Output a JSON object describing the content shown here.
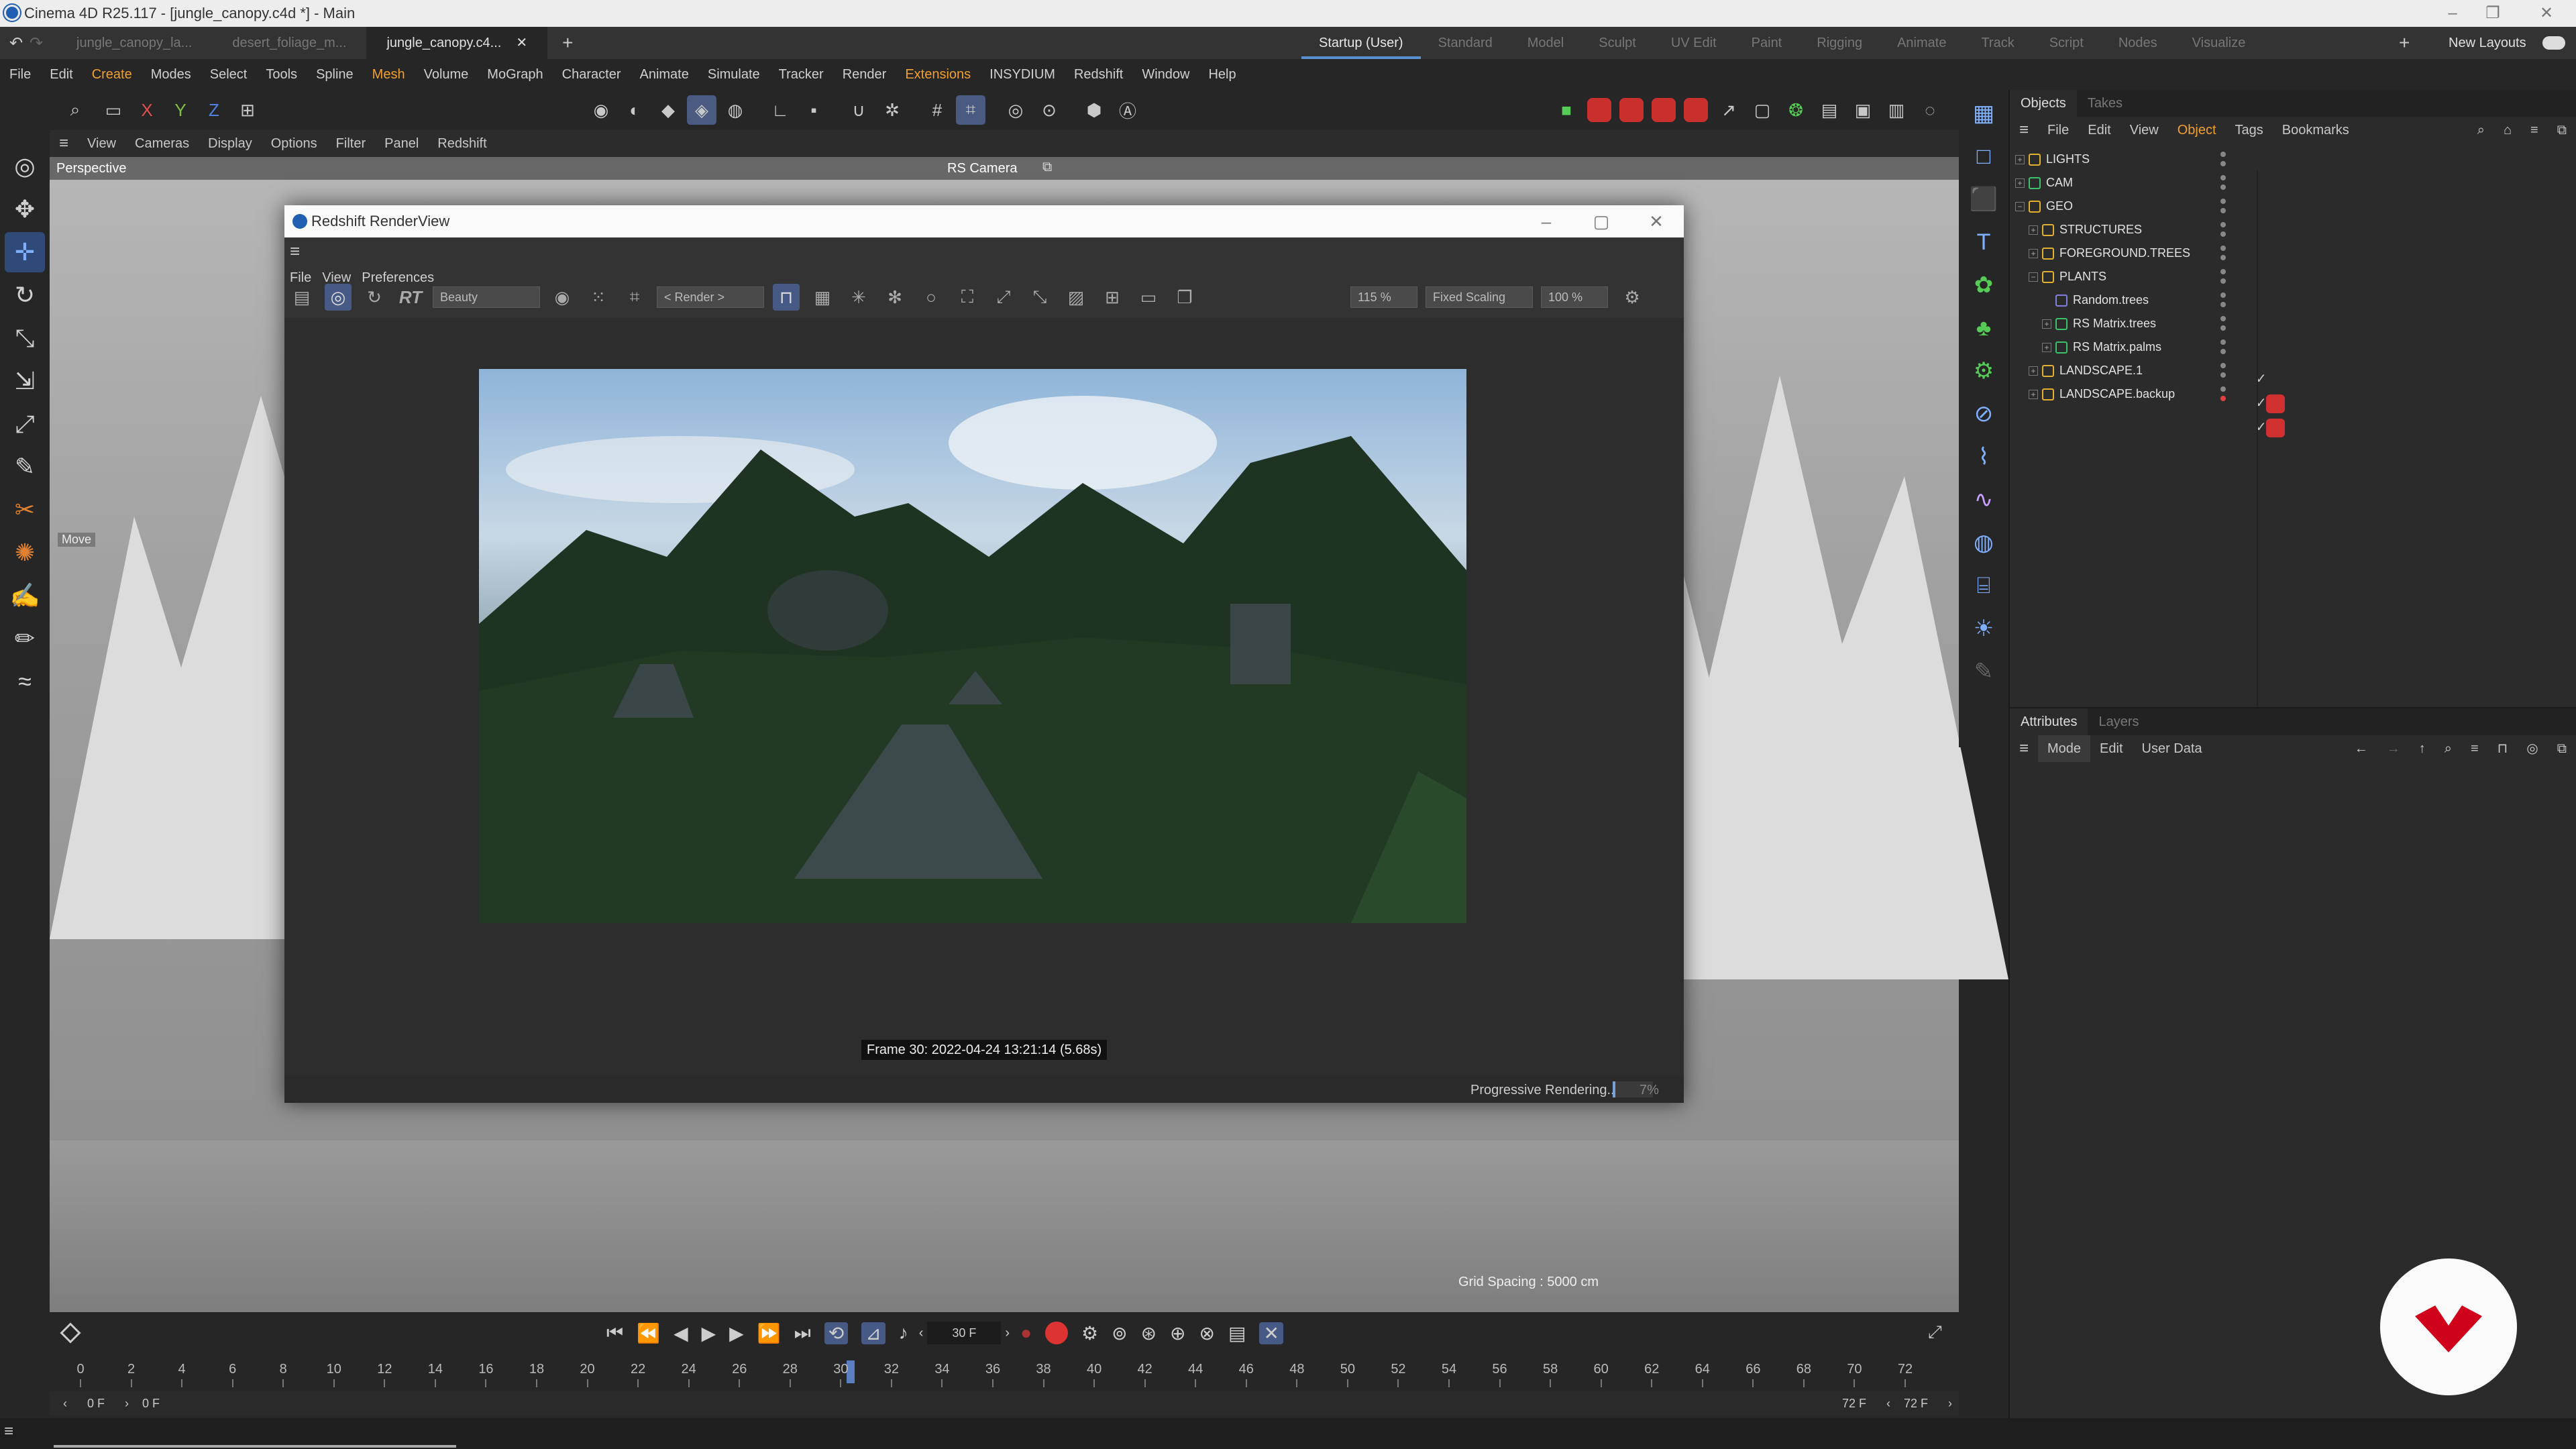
{
  "window": {
    "title": "Cinema 4D R25.117 - [jungle_canopy.c4d *] - Main"
  },
  "doc_tabs": [
    {
      "label": "jungle_canopy_la..."
    },
    {
      "label": "desert_foliage_m..."
    },
    {
      "label": "jungle_canopy.c4..."
    }
  ],
  "layout_tabs": [
    "Startup (User)",
    "Standard",
    "Model",
    "Sculpt",
    "UV Edit",
    "Paint",
    "Rigging",
    "Animate",
    "Track",
    "Script",
    "Nodes",
    "Visualize"
  ],
  "new_layouts": "New Layouts",
  "menu": [
    "File",
    "Edit",
    "Create",
    "Modes",
    "Select",
    "Tools",
    "Spline",
    "Mesh",
    "Volume",
    "MoGraph",
    "Character",
    "Animate",
    "Simulate",
    "Tracker",
    "Render",
    "Extensions",
    "INSYDIUM",
    "Redshift",
    "Window",
    "Help"
  ],
  "axis_buttons": {
    "x": "X",
    "y": "Y",
    "z": "Z"
  },
  "viewport": {
    "menu": [
      "View",
      "Cameras",
      "Display",
      "Options",
      "Filter",
      "Panel",
      "Redshift"
    ],
    "name": "Perspective",
    "camera": "RS Camera",
    "tool_label": "Move",
    "grid_spacing": "Grid Spacing : 5000 cm"
  },
  "renderview": {
    "title": "Redshift RenderView",
    "menu": [
      "File",
      "View",
      "Preferences"
    ],
    "rt_label": "RT",
    "aov": "Beauty",
    "render_dd": "< Render >",
    "zoom": "115 %",
    "scaling": "Fixed Scaling",
    "scale_pct": "100 %",
    "frame_info": "Frame 30:  2022-04-24  13:21:14  (5.68s)",
    "status": "Progressive Rendering...",
    "progress": "7%"
  },
  "objects": {
    "tabs": [
      "Objects",
      "Takes"
    ],
    "menu": [
      "File",
      "Edit",
      "View",
      "Object",
      "Tags",
      "Bookmarks"
    ],
    "items": [
      {
        "label": "LIGHTS",
        "indent": 0,
        "icon": "null"
      },
      {
        "label": "CAM",
        "indent": 0,
        "icon": "obj"
      },
      {
        "label": "GEO",
        "indent": 0,
        "icon": "null"
      },
      {
        "label": "STRUCTURES",
        "indent": 1,
        "icon": "null"
      },
      {
        "label": "FOREGROUND.TREES",
        "indent": 1,
        "icon": "null"
      },
      {
        "label": "PLANTS",
        "indent": 1,
        "icon": "null"
      },
      {
        "label": "Random.trees",
        "indent": 2,
        "icon": "obj"
      },
      {
        "label": "RS Matrix.trees",
        "indent": 2,
        "icon": "obj"
      },
      {
        "label": "RS Matrix.palms",
        "indent": 2,
        "icon": "obj"
      },
      {
        "label": "LANDSCAPE.1",
        "indent": 1,
        "icon": "null"
      },
      {
        "label": "LANDSCAPE.backup",
        "indent": 1,
        "icon": "null"
      }
    ]
  },
  "attributes": {
    "tabs": [
      "Attributes",
      "Layers"
    ],
    "menu": [
      "Mode",
      "Edit",
      "User Data"
    ]
  },
  "timeline": {
    "current_frame": "30 F",
    "start": "0 F",
    "start2": "0 F",
    "end": "72 F",
    "end2": "72 F",
    "ticks": [
      "0",
      "2",
      "4",
      "6",
      "8",
      "10",
      "12",
      "14",
      "16",
      "18",
      "20",
      "22",
      "24",
      "26",
      "28",
      "30",
      "32",
      "34",
      "36",
      "38",
      "40",
      "42",
      "44",
      "46",
      "48",
      "50",
      "52",
      "54",
      "56",
      "58",
      "60",
      "62",
      "64",
      "66",
      "68",
      "70",
      "72"
    ]
  },
  "colors": {
    "accent": "#4a6fa5",
    "highlight_menu": "#f0a030",
    "brand": "#d0021b"
  }
}
